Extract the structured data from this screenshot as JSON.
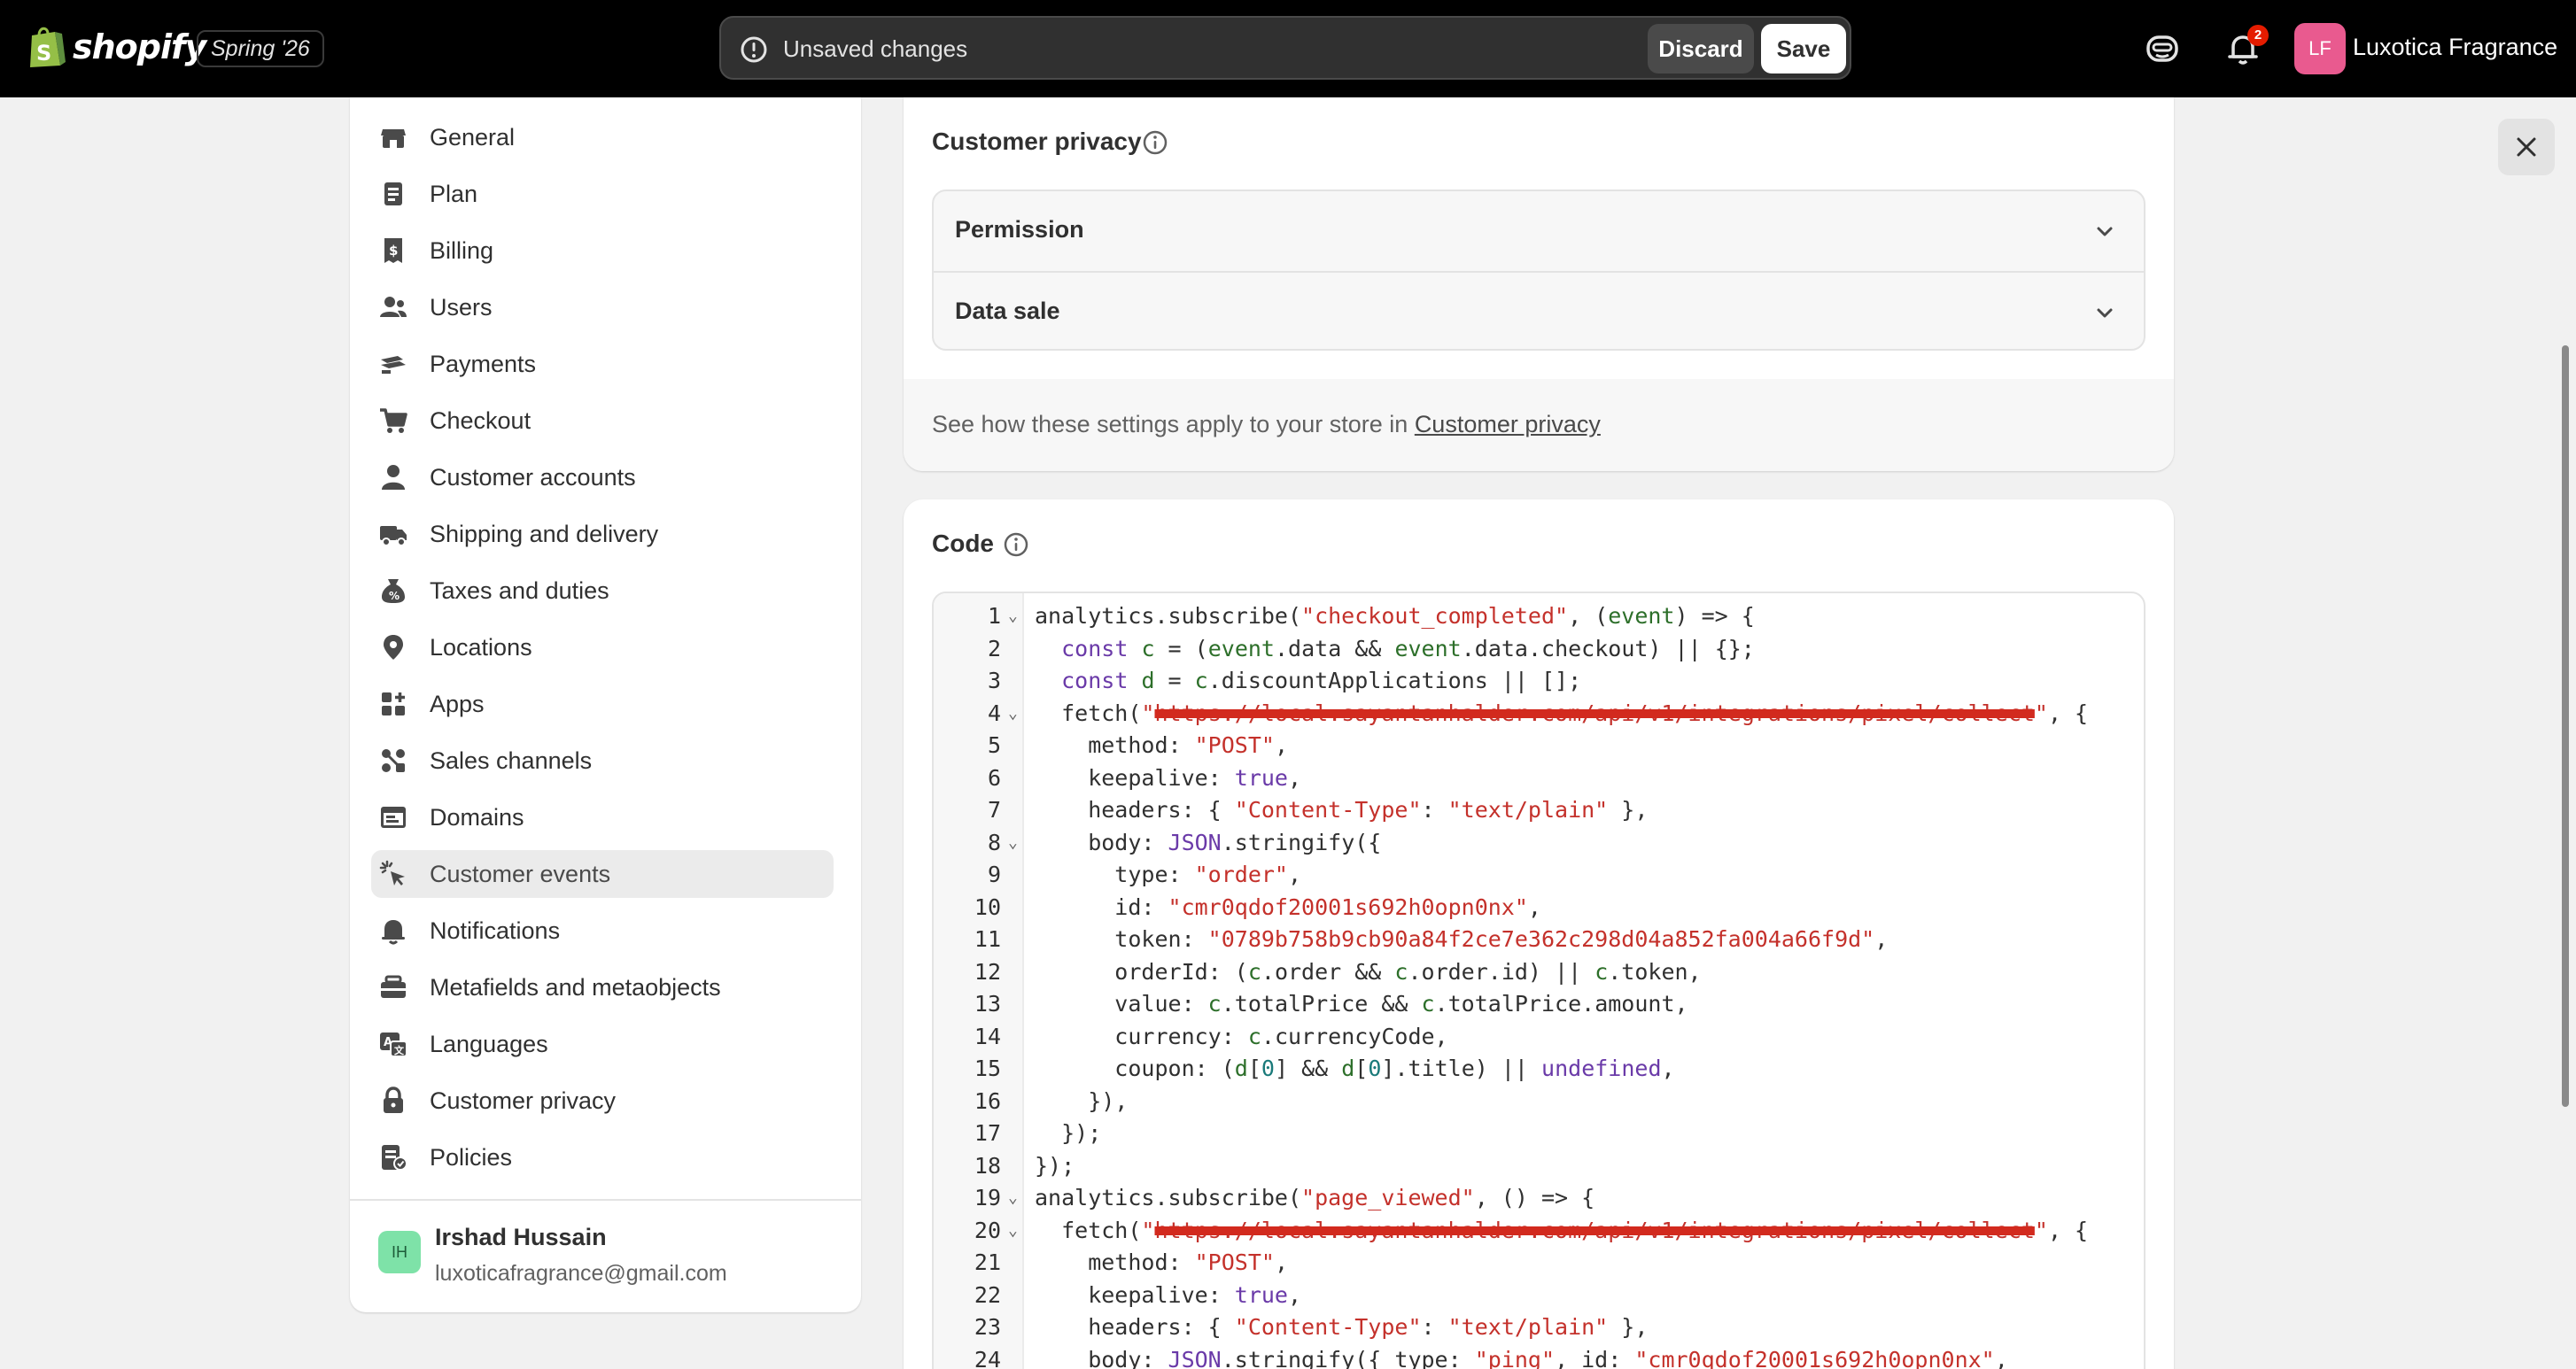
{
  "topbar": {
    "brand": "shopify",
    "edition": "Spring '26",
    "unsaved_text": "Unsaved changes",
    "discard_label": "Discard",
    "save_label": "Save",
    "notifications_count": "2",
    "store_initials": "LF",
    "store_name": "Luxotica Fragrance"
  },
  "sidebar": {
    "items": [
      {
        "label": "General",
        "icon": "store-icon"
      },
      {
        "label": "Plan",
        "icon": "plan-icon"
      },
      {
        "label": "Billing",
        "icon": "billing-icon"
      },
      {
        "label": "Users",
        "icon": "users-icon"
      },
      {
        "label": "Payments",
        "icon": "payments-icon"
      },
      {
        "label": "Checkout",
        "icon": "cart-icon"
      },
      {
        "label": "Customer accounts",
        "icon": "person-icon"
      },
      {
        "label": "Shipping and delivery",
        "icon": "truck-icon"
      },
      {
        "label": "Taxes and duties",
        "icon": "taxes-icon"
      },
      {
        "label": "Locations",
        "icon": "location-icon"
      },
      {
        "label": "Apps",
        "icon": "apps-icon"
      },
      {
        "label": "Sales channels",
        "icon": "sales-channels-icon"
      },
      {
        "label": "Domains",
        "icon": "domains-icon"
      },
      {
        "label": "Customer events",
        "icon": "cursor-click-icon"
      },
      {
        "label": "Notifications",
        "icon": "bell-icon"
      },
      {
        "label": "Metafields and metaobjects",
        "icon": "metafields-icon"
      },
      {
        "label": "Languages",
        "icon": "languages-icon"
      },
      {
        "label": "Customer privacy",
        "icon": "lock-icon"
      },
      {
        "label": "Policies",
        "icon": "policies-icon"
      }
    ],
    "active_item": "Customer events",
    "user": {
      "initials": "IH",
      "name": "Irshad Hussain",
      "email": "luxoticafragrance@gmail.com"
    }
  },
  "privacy_card": {
    "title": "Customer privacy",
    "sections": [
      "Permission",
      "Data sale"
    ],
    "footer_text": "See how these settings apply to your store in ",
    "footer_link": "Customer privacy"
  },
  "code_card": {
    "title": "Code",
    "lines": [
      "analytics.subscribe(\"checkout_completed\", (event) => {",
      "  const c = (event.data && event.data.checkout) || {};",
      "  const d = c.discountApplications || [];",
      "  fetch(\"https://local.sayantanhalder.com/api/v1/integrations/pixel/collect\", {",
      "    method: \"POST\",",
      "    keepalive: true,",
      "    headers: { \"Content-Type\": \"text/plain\" },",
      "    body: JSON.stringify({",
      "      type: \"order\",",
      "      id: \"cmr0qdof20001s692h0opn0nx\",",
      "      token: \"0789b758b9cb90a84f2ce7e362c298d04a852fa004a66f9d\",",
      "      orderId: (c.order && c.order.id) || c.token,",
      "      value: c.totalPrice && c.totalPrice.amount,",
      "      currency: c.currencyCode,",
      "      coupon: (d[0] && d[0].title) || undefined,",
      "    }),",
      "  });",
      "});",
      "analytics.subscribe(\"page_viewed\", () => {",
      "  fetch(\"https://local.sayantanhalder.com/api/v1/integrations/pixel/collect\", {",
      "    method: \"POST\",",
      "    keepalive: true,",
      "    headers: { \"Content-Type\": \"text/plain\" },",
      "    body: JSON.stringify({ type: \"ping\", id: \"cmr0qdof20001s692h0opn0nx\","
    ],
    "folded_lines": [
      1,
      4,
      8,
      19,
      20
    ],
    "redacted_lines": [
      4,
      20
    ]
  },
  "colors": {
    "topbar_bg": "#000000",
    "page_bg": "#f1f1f1",
    "active_nav_bg": "#ebebeb",
    "badge_red": "#e51c00",
    "store_avatar": "#e95a8f",
    "user_avatar": "#7ee2a8",
    "redaction_mark": "#d22a1e"
  }
}
